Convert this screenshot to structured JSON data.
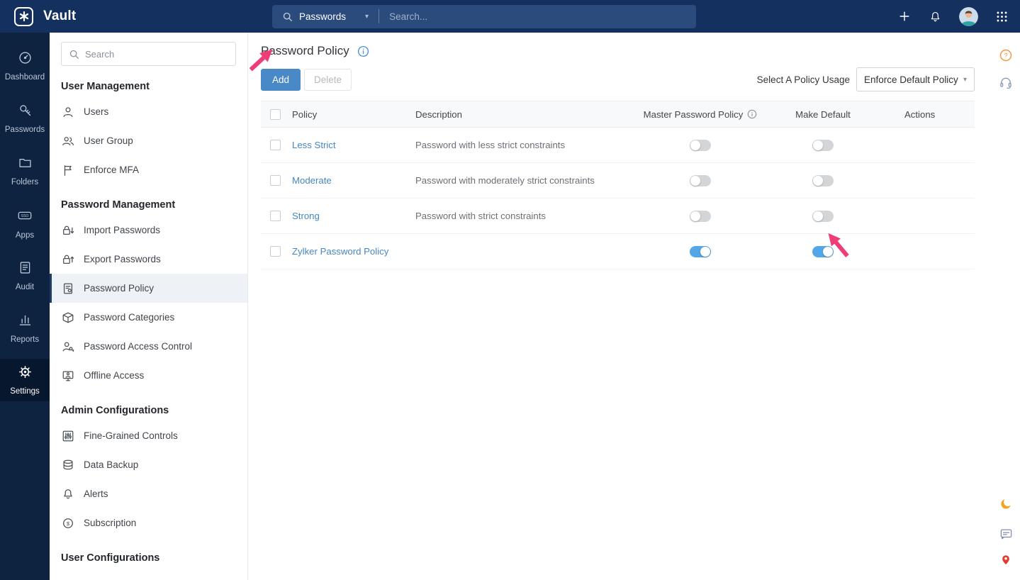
{
  "topbar": {
    "app_name": "Vault",
    "search_scope": "Passwords",
    "search_placeholder": "Search..."
  },
  "left_rail": {
    "items": [
      {
        "label": "Dashboard",
        "icon": "dashboard-icon",
        "active": false
      },
      {
        "label": "Passwords",
        "icon": "key-icon",
        "active": false
      },
      {
        "label": "Folders",
        "icon": "folder-icon",
        "active": false
      },
      {
        "label": "Apps",
        "icon": "sso-icon",
        "active": false
      },
      {
        "label": "Audit",
        "icon": "audit-icon",
        "active": false
      },
      {
        "label": "Reports",
        "icon": "chart-icon",
        "active": false
      },
      {
        "label": "Settings",
        "icon": "gear-icon",
        "active": true
      }
    ]
  },
  "sidebar": {
    "search_placeholder": "Search",
    "sections": [
      {
        "title": "User Management",
        "items": [
          {
            "label": "Users",
            "icon": "user-icon"
          },
          {
            "label": "User Group",
            "icon": "user-group-icon"
          },
          {
            "label": "Enforce MFA",
            "icon": "flag-icon"
          }
        ]
      },
      {
        "title": "Password Management",
        "items": [
          {
            "label": "Import Passwords",
            "icon": "lock-import-icon"
          },
          {
            "label": "Export Passwords",
            "icon": "lock-export-icon"
          },
          {
            "label": "Password Policy",
            "icon": "policy-doc-icon",
            "active": true
          },
          {
            "label": "Password Categories",
            "icon": "categories-icon"
          },
          {
            "label": "Password Access Control",
            "icon": "access-control-icon"
          },
          {
            "label": "Offline Access",
            "icon": "offline-access-icon"
          }
        ]
      },
      {
        "title": "Admin Configurations",
        "items": [
          {
            "label": "Fine-Grained Controls",
            "icon": "controls-icon"
          },
          {
            "label": "Data Backup",
            "icon": "backup-icon"
          },
          {
            "label": "Alerts",
            "icon": "alert-bell-icon"
          },
          {
            "label": "Subscription",
            "icon": "subscription-icon"
          }
        ]
      },
      {
        "title": "User Configurations",
        "items": []
      }
    ]
  },
  "main": {
    "page_title": "Password Policy",
    "toolbar": {
      "add_label": "Add",
      "delete_label": "Delete",
      "policy_usage_label": "Select A Policy Usage",
      "policy_usage_value": "Enforce Default Policy"
    },
    "table": {
      "headers": {
        "policy": "Policy",
        "description": "Description",
        "master": "Master Password Policy",
        "make_default": "Make Default",
        "actions": "Actions"
      },
      "rows": [
        {
          "policy": "Less Strict",
          "description": "Password with less strict constraints",
          "master_on": false,
          "default_on": false
        },
        {
          "policy": "Moderate",
          "description": "Password with moderately strict constraints",
          "master_on": false,
          "default_on": false
        },
        {
          "policy": "Strong",
          "description": "Password with strict constraints",
          "master_on": false,
          "default_on": false
        },
        {
          "policy": "Zylker Password Policy",
          "description": "",
          "master_on": true,
          "default_on": true
        }
      ]
    }
  },
  "colors": {
    "topbar_bg": "#14305f",
    "rail_bg": "#0e2340",
    "accent_blue": "#4a89c8",
    "toggle_on": "#53a7e8",
    "link_blue": "#4687c1",
    "arrow_pink": "#ee3d77",
    "help_orange": "#f2953b"
  }
}
